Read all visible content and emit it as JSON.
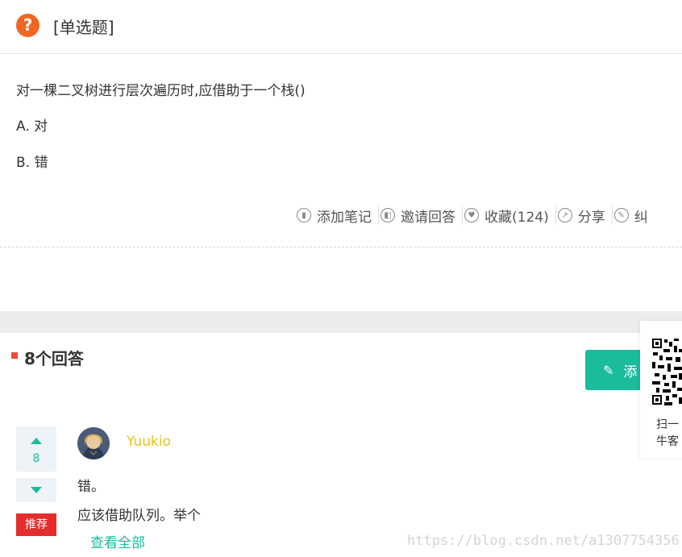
{
  "header": {
    "icon_glyph": "?",
    "question_type": "[单选题]"
  },
  "question": {
    "text": "对一棵二叉树进行层次遍历时,应借助于一个栈()",
    "options": [
      {
        "label": "A. 对"
      },
      {
        "label": "B. 错"
      }
    ]
  },
  "actions": [
    {
      "icon": "book-icon",
      "label": "添加笔记"
    },
    {
      "icon": "invite-icon",
      "label": "邀请回答"
    },
    {
      "icon": "heart-icon",
      "label": "收藏(124)"
    },
    {
      "icon": "share-icon",
      "label": "分享"
    },
    {
      "icon": "pencil-icon",
      "label": "纠"
    }
  ],
  "answers_section": {
    "count_label": "8个回答",
    "add_button_label": "添",
    "side_panel": {
      "line1": "扫一",
      "line2": "牛客"
    }
  },
  "answer": {
    "votes": "8",
    "badge": "推荐",
    "username": "Yuukio",
    "lines": [
      "错。",
      "应该借助队列。举个"
    ],
    "view_all": "查看全部"
  },
  "watermark": "https://blog.csdn.net/a1307754356",
  "colors": {
    "accent": "#1abc9c",
    "question_icon": "#f26522",
    "badge": "#e52d2d",
    "username": "#e8c21a",
    "marker": "#f04a36"
  }
}
